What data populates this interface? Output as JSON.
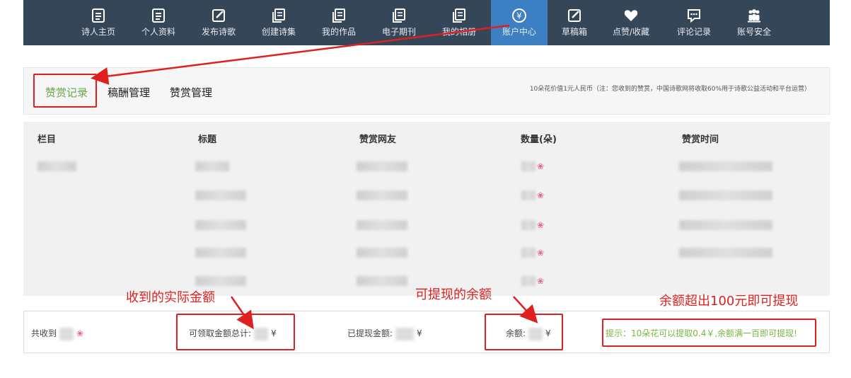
{
  "nav": {
    "items": [
      {
        "label": "诗人主页",
        "icon": "list-doc-icon"
      },
      {
        "label": "个人资料",
        "icon": "list-doc-icon"
      },
      {
        "label": "发布诗歌",
        "icon": "edit-icon"
      },
      {
        "label": "创建诗集",
        "icon": "copy-doc-icon"
      },
      {
        "label": "我的作品",
        "icon": "copy-doc-icon"
      },
      {
        "label": "电子期刊",
        "icon": "copy-doc-icon"
      },
      {
        "label": "我的相册",
        "icon": "copy-doc-icon"
      },
      {
        "label": "账户中心",
        "icon": "yen-circle-icon"
      },
      {
        "label": "草稿箱",
        "icon": "edit-icon"
      },
      {
        "label": "点赞/收藏",
        "icon": "heart-icon"
      },
      {
        "label": "评论记录",
        "icon": "comment-icon"
      },
      {
        "label": "账号安全",
        "icon": "users-icon"
      }
    ],
    "active_index": 7
  },
  "tabs": {
    "items": [
      "赞赏记录",
      "稿酬管理",
      "赞赏管理"
    ],
    "active_index": 0,
    "note": "10朵花价值1元人民币（注：您收到的赞赏，中国诗歌网将收取60%用于诗歌公益活动和平台运营）"
  },
  "table": {
    "headers": [
      "栏目",
      "标题",
      "赞赏网友",
      "数量(朵)",
      "赞赏时间"
    ],
    "row_count": 5
  },
  "footer": {
    "received_label": "共收到",
    "claimable_label": "可领取金额总计:",
    "withdrawn_label": "已提现金额:",
    "balance_label": "余额:",
    "currency": "¥",
    "tip": "提示：10朵花可以提取0.4￥,余额满一百即可提现!"
  },
  "annotations": {
    "actual_amount": "收到的实际金额",
    "withdrawable": "可提现的余额",
    "threshold": "余额超出100元即可提现"
  },
  "colors": {
    "nav_bg": "#364659",
    "nav_active": "#3c7fc2",
    "tab_active": "#6aa64b",
    "tip_green": "#7bb641",
    "annotation_red": "#e02020"
  }
}
